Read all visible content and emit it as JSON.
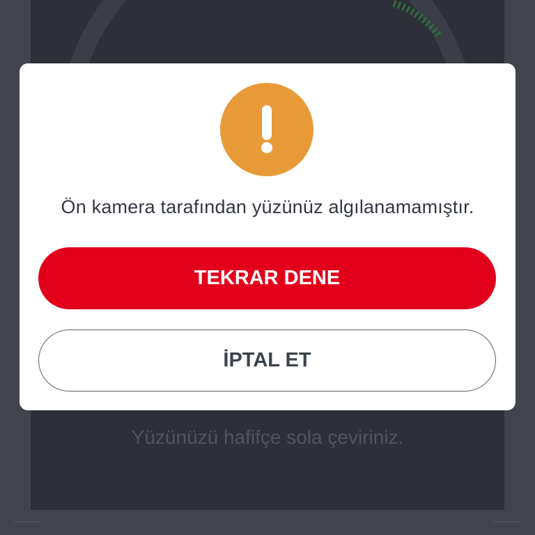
{
  "background": {
    "hint_text": "Yüzünüzü hafifçe sola çeviriniz."
  },
  "dialog": {
    "icon": "exclamation-icon",
    "message": "Ön kamera tarafından yüzünüz algılanamamıştır.",
    "retry_label": "TEKRAR DENE",
    "cancel_label": "İPTAL ET"
  },
  "colors": {
    "accent_red": "#e3001b",
    "warning_orange": "#e89a38",
    "overlay_dark": "#2d3038"
  }
}
